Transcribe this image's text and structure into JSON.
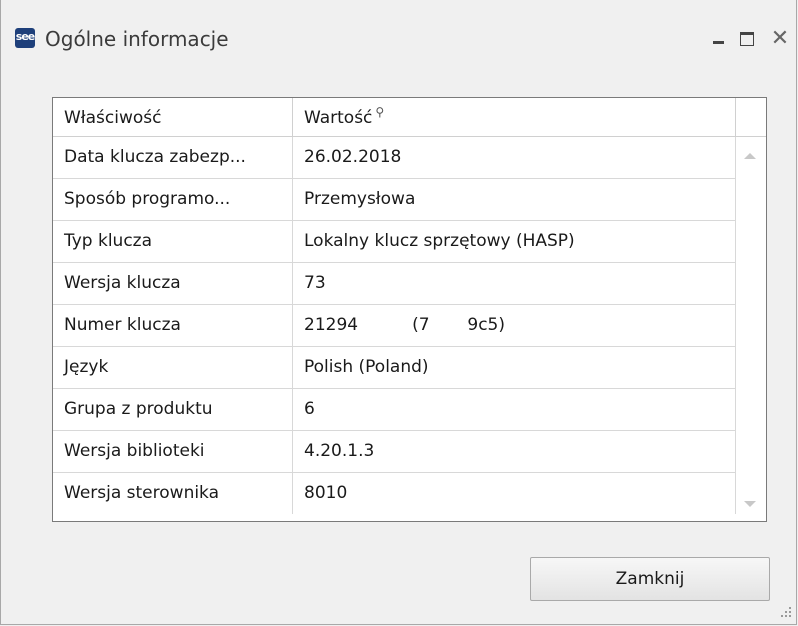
{
  "window": {
    "title": "Ogólne informacje",
    "app_icon_text": "see"
  },
  "grid": {
    "columns": [
      "Właściwość",
      "Wartość"
    ],
    "rows": [
      [
        "Data klucza zabezp...",
        "26.02.2018"
      ],
      [
        "Sposób programo...",
        "Przemysłowa"
      ],
      [
        "Typ klucza",
        "Lokalny klucz sprzętowy (HASP)"
      ],
      [
        "Wersja klucza",
        "73"
      ],
      [
        "Numer klucza",
        "21294          (7       9c5)"
      ],
      [
        "Język",
        "Polish (Poland)"
      ],
      [
        "Grupa z produktu",
        "6"
      ],
      [
        "Wersja biblioteki",
        "4.20.1.3"
      ],
      [
        "Wersja sterownika",
        "8010"
      ]
    ]
  },
  "buttons": {
    "close_label": "Zamknij"
  },
  "icons": {
    "filter": "filter-icon",
    "close": "close-icon",
    "minimize": "minimize-icon",
    "maximize": "maximize-icon"
  }
}
